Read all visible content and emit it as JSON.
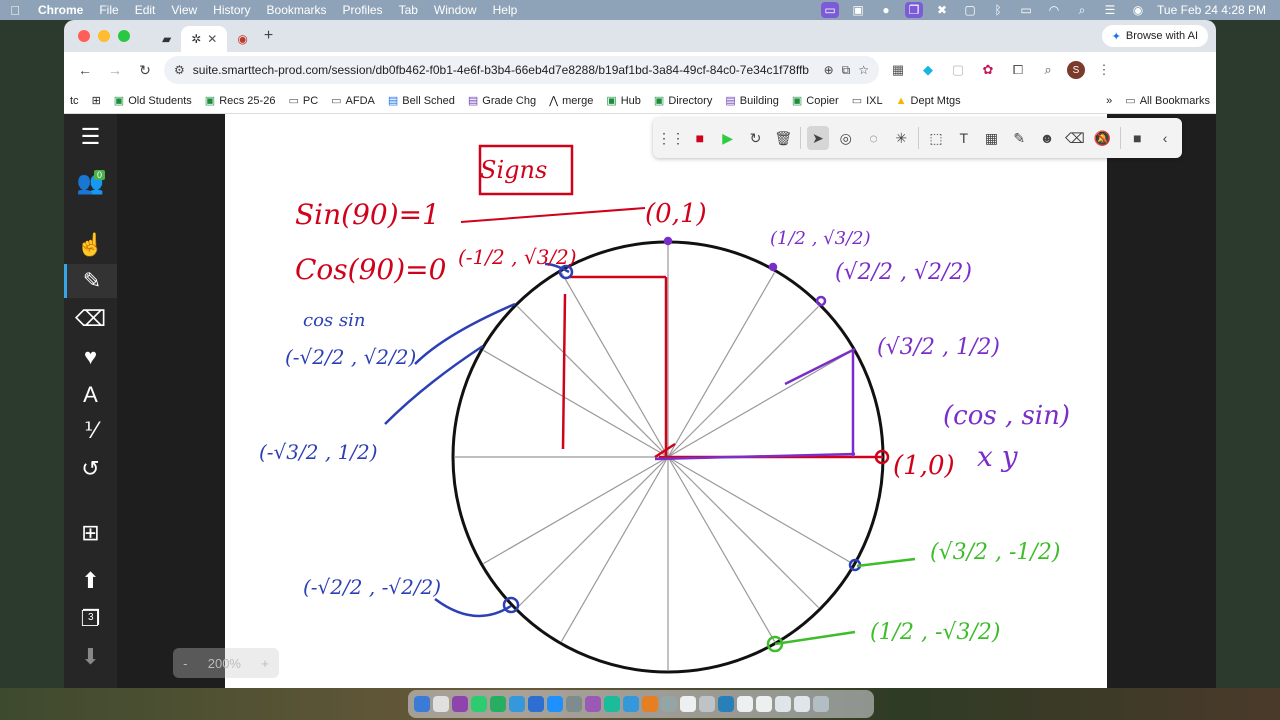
{
  "menubar": {
    "items": [
      "Chrome",
      "File",
      "Edit",
      "View",
      "History",
      "Bookmarks",
      "Profiles",
      "Tab",
      "Window",
      "Help"
    ],
    "datetime": "Tue Feb 24  4:28 PM"
  },
  "browser": {
    "browse_ai_label": "Browse with AI",
    "url": "suite.smarttech-prod.com/session/db0fb462-f0b1-4e6f-b3b4-66eb4d7e8288/b19af1bd-3a84-49cf-84c0-7e34c1f78ffb",
    "avatar_letter": "S",
    "bookmarks": [
      {
        "label": "Old Students",
        "icon": "sheets-icon"
      },
      {
        "label": "Recs 25-26",
        "icon": "sheets-icon"
      },
      {
        "label": "PC",
        "icon": "folder-icon"
      },
      {
        "label": "AFDA",
        "icon": "folder-icon"
      },
      {
        "label": "Bell Sched",
        "icon": "docs-icon"
      },
      {
        "label": "Grade Chg",
        "icon": "forms-icon"
      },
      {
        "label": "merge",
        "icon": "merge-icon"
      },
      {
        "label": "Hub",
        "icon": "sheets-icon"
      },
      {
        "label": "Directory",
        "icon": "sheets-icon"
      },
      {
        "label": "Building",
        "icon": "forms-icon"
      },
      {
        "label": "Copier",
        "icon": "sheets-icon"
      },
      {
        "label": "IXL",
        "icon": "folder-icon"
      },
      {
        "label": "Dept Mtgs",
        "icon": "drive-icon"
      }
    ],
    "bookmark_prefix": "tc",
    "all_bookmarks_label": "All Bookmarks"
  },
  "sidebar": {
    "participants_count": "0",
    "page_count": "3"
  },
  "zoom": {
    "minus": "-",
    "value": "200%",
    "plus": "+"
  },
  "whiteboard": {
    "title": "Signs",
    "sin_note": "Sin(90)=1",
    "cos_note": "Cos(90)=0",
    "labels": {
      "top": "(0,1)",
      "right": "(1,0)",
      "q1_30": "(√3/2 , 1/2)",
      "q1_45": "(√2/2 , √2/2)",
      "q1_60": "(1/2 , √3/2)",
      "q2_120": "(-1/2 , √3/2)",
      "q2_135": "(-√2/2 , √2/2)",
      "q2_150": "(-√3/2 , 1/2)",
      "q3_225": "(-√2/2 , -√2/2)",
      "q4_300": "(1/2 , -√3/2)",
      "q4_330": "(√3/2 , -1/2)",
      "cos_sin": "(cos , sin)",
      "xy": "x   y",
      "cos_sin_note": "cos sin"
    },
    "colors": {
      "red": "#d0021b",
      "purple": "#7a2ec9",
      "blue": "#2d3fb5",
      "green": "#3dbd2a"
    }
  }
}
